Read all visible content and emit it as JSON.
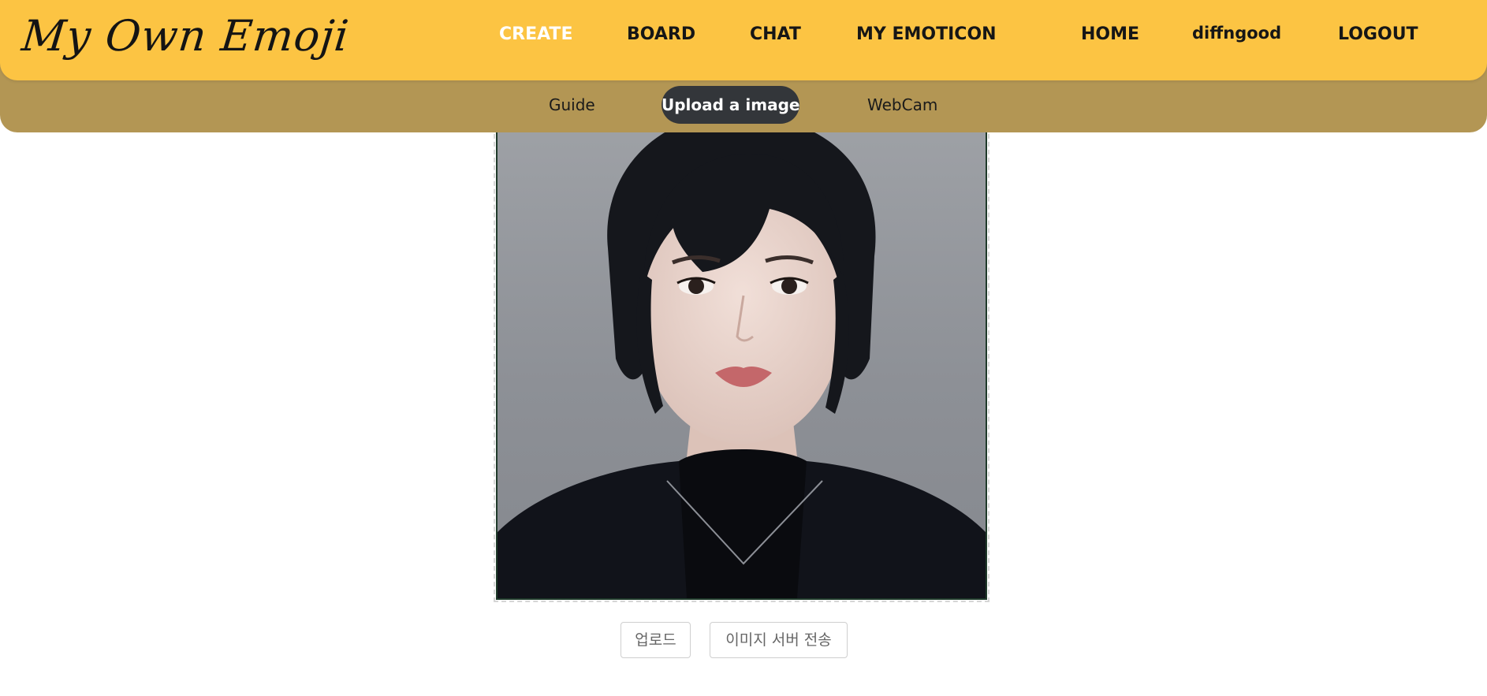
{
  "header": {
    "logo": "My Own Emoji",
    "nav": {
      "create": "CREATE",
      "board": "BOARD",
      "chat": "CHAT",
      "my_emoticon": "MY EMOTICON",
      "home": "HOME",
      "username": "diffngood",
      "logout": "LOGOUT"
    },
    "active_nav": "CREATE",
    "accent": "#fcc443"
  },
  "subnav": {
    "guide": "Guide",
    "upload": "Upload a image",
    "webcam": "WebCam",
    "active": "Upload a image",
    "background": "#b39654"
  },
  "preview": {
    "image": "uploaded-portrait-photo"
  },
  "actions": {
    "upload_label": "업로드",
    "send_label": "이미지 서버 전송"
  }
}
